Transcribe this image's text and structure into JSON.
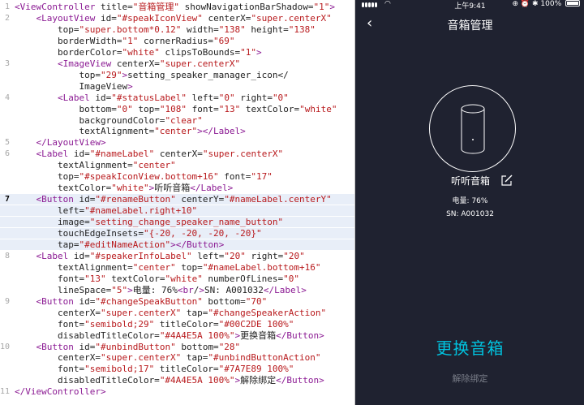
{
  "editor": {
    "lines": [
      {
        "num": "1",
        "active": false,
        "hl": false,
        "text": "<ViewController title=\"音箱管理\" showNavigationBarShadow=\"1\">"
      },
      {
        "num": "2",
        "active": false,
        "hl": false,
        "text": "    <LayoutView id=\"#speakIconView\" centerX=\"super.centerX\""
      },
      {
        "num": "",
        "active": false,
        "hl": false,
        "text": "        top=\"super.bottom*0.12\" width=\"138\" height=\"138\""
      },
      {
        "num": "",
        "active": false,
        "hl": false,
        "text": "        borderWidth=\"1\" cornerRadius=\"69\""
      },
      {
        "num": "",
        "active": false,
        "hl": false,
        "text": "        borderColor=\"white\" clipsToBounds=\"1\">"
      },
      {
        "num": "3",
        "active": false,
        "hl": false,
        "text": "        <ImageView centerX=\"super.centerX\""
      },
      {
        "num": "",
        "active": false,
        "hl": false,
        "text": "            top=\"29\">setting_speaker_manager_icon</"
      },
      {
        "num": "",
        "active": false,
        "hl": false,
        "text": "            ImageView>"
      },
      {
        "num": "4",
        "active": false,
        "hl": false,
        "text": "        <Label id=\"#statusLabel\" left=\"0\" right=\"0\""
      },
      {
        "num": "",
        "active": false,
        "hl": false,
        "text": "            bottom=\"0\" top=\"108\" font=\"13\" textColor=\"white\""
      },
      {
        "num": "",
        "active": false,
        "hl": false,
        "text": "            backgroundColor=\"clear\""
      },
      {
        "num": "",
        "active": false,
        "hl": false,
        "text": "            textAlignment=\"center\"></Label>"
      },
      {
        "num": "5",
        "active": false,
        "hl": false,
        "text": "    </LayoutView>"
      },
      {
        "num": "6",
        "active": false,
        "hl": false,
        "text": "    <Label id=\"#nameLabel\" centerX=\"super.centerX\""
      },
      {
        "num": "",
        "active": false,
        "hl": false,
        "text": "        textAlignment=\"center\""
      },
      {
        "num": "",
        "active": false,
        "hl": false,
        "text": "        top=\"#speakIconView.bottom+16\" font=\"17\""
      },
      {
        "num": "",
        "active": false,
        "hl": false,
        "text": "        textColor=\"white\">听听音箱</Label>"
      },
      {
        "num": "7",
        "active": true,
        "hl": true,
        "text": "    <Button id=\"#renameButton\" centerY=\"#nameLabel.centerY\""
      },
      {
        "num": "",
        "active": false,
        "hl": true,
        "text": "        left=\"#nameLabel.right+10\""
      },
      {
        "num": "",
        "active": false,
        "hl": true,
        "text": "        image=\"setting_change_speaker_name_button\""
      },
      {
        "num": "",
        "active": false,
        "hl": true,
        "text": "        touchEdgeInsets=\"{-20, -20, -20, -20}\""
      },
      {
        "num": "",
        "active": false,
        "hl": true,
        "text": "        tap=\"#editNameAction\"></Button>"
      },
      {
        "num": "8",
        "active": false,
        "hl": false,
        "text": "    <Label id=\"#speakerInfoLabel\" left=\"20\" right=\"20\""
      },
      {
        "num": "",
        "active": false,
        "hl": false,
        "text": "        textAlignment=\"center\" top=\"#nameLabel.bottom+16\""
      },
      {
        "num": "",
        "active": false,
        "hl": false,
        "text": "        font=\"13\" textColor=\"white\" numberOfLines=\"0\""
      },
      {
        "num": "",
        "active": false,
        "hl": false,
        "text": "        lineSpace=\"5\">电量: 76%<br/>SN: A001032</Label>"
      },
      {
        "num": "9",
        "active": false,
        "hl": false,
        "text": "    <Button id=\"#changeSpeakButton\" bottom=\"70\""
      },
      {
        "num": "",
        "active": false,
        "hl": false,
        "text": "        centerX=\"super.centerX\" tap=\"#changeSpeakerAction\""
      },
      {
        "num": "",
        "active": false,
        "hl": false,
        "text": "        font=\"semibold;29\" titleColor=\"#00C2DE 100%\""
      },
      {
        "num": "",
        "active": false,
        "hl": false,
        "text": "        disabledTitleColor=\"#4A4E5A 100%\">更换音箱</Button>"
      },
      {
        "num": "10",
        "active": false,
        "hl": false,
        "text": "    <Button id=\"#unbindButton\" bottom=\"28\""
      },
      {
        "num": "",
        "active": false,
        "hl": false,
        "text": "        centerX=\"super.centerX\" tap=\"#unbindButtonAction\""
      },
      {
        "num": "",
        "active": false,
        "hl": false,
        "text": "        font=\"semibold;17\" titleColor=\"#7A7E89 100%\""
      },
      {
        "num": "",
        "active": false,
        "hl": false,
        "text": "        disabledTitleColor=\"#4A4E5A 100%\">解除绑定</Button>"
      },
      {
        "num": "11",
        "active": false,
        "hl": false,
        "text": "</ViewController>"
      }
    ]
  },
  "phone": {
    "status": {
      "time": "上午9:41",
      "battery": "100%",
      "icons": "⊕ ⏰ ✱"
    },
    "nav": {
      "back": "‹",
      "title": "音箱管理"
    },
    "name_label": "听听音箱",
    "info_line1": "电量: 76%",
    "info_line2": "SN: A001032",
    "change_button": "更换音箱",
    "unbind_button": "解除绑定",
    "colors": {
      "background": "#1F2230",
      "accent": "#00C2DE",
      "unbind": "#7A7E89"
    }
  }
}
